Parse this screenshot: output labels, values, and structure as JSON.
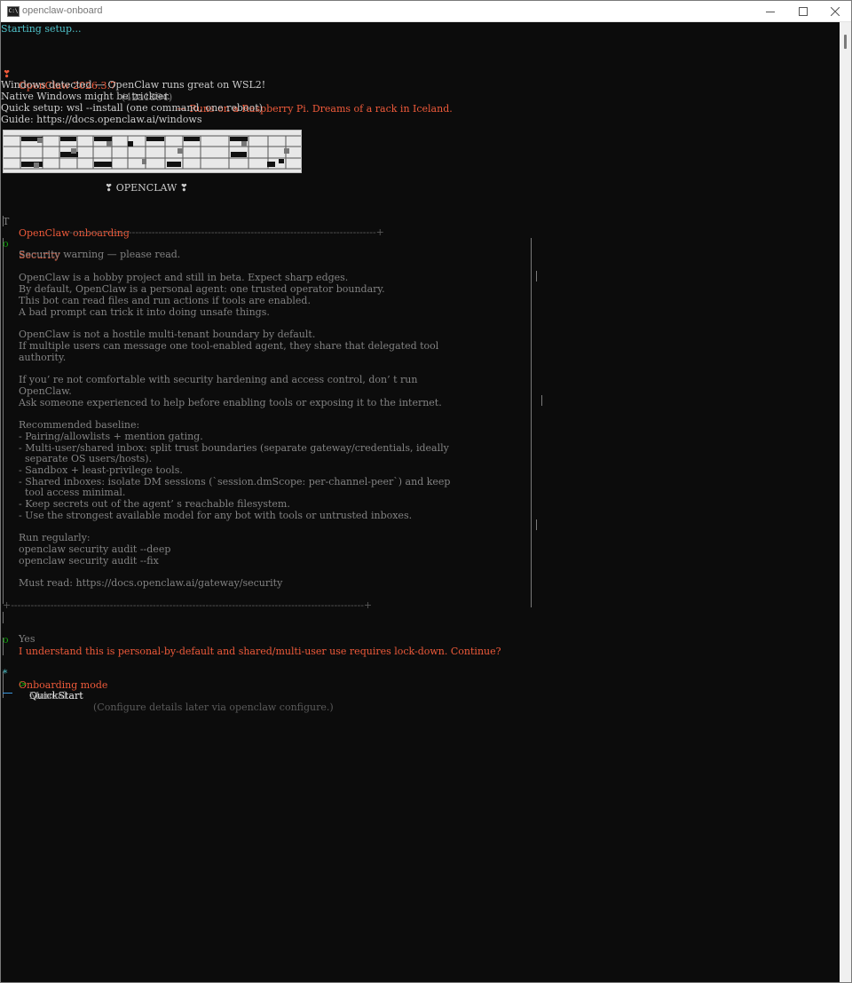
{
  "window": {
    "title": "openclaw-onboard",
    "icon": "C:\\",
    "icon_name": "terminal-icon",
    "controls": [
      "minimize-icon",
      "maximize-icon",
      "close-icon"
    ]
  },
  "colors": {
    "background": "#0c0c0c",
    "cyan": "#4fc1c9",
    "orange_red": "#ef5a3a",
    "gray": "#828282",
    "text": "#cccccc",
    "green": "#13a10e",
    "cursor": "#3a96dd"
  },
  "terminal": {
    "starting": "Starting setup...",
    "header": {
      "glyph": "❣",
      "name": "OpenClaw 2026.3.7",
      "commit": "(42a1394)",
      "tagline": "— Runs on a Raspberry Pi. Dreams of a rack in Iceland."
    },
    "windows_notice": [
      "Windows detected — OpenClaw runs great on WSL2!",
      "Native Windows might be trickier.",
      "Quick setup: wsl --install (one command, one reboot)",
      "Guide: https://docs.openclaw.ai/windows"
    ],
    "banner_subtitle": "❣ OPENCLAW ❣",
    "onboarding_marker": "T",
    "onboarding_title": "OpenClaw onboarding",
    "security": {
      "marker": "o",
      "title": "Security",
      "warning_lead": "Security warning — please read.",
      "paragraph1": [
        "OpenClaw is a hobby project and still in beta. Expect sharp edges.",
        "By default, OpenClaw is a personal agent: one trusted operator boundary.",
        "This bot can read files and run actions if tools are enabled.",
        "A bad prompt can trick it into doing unsafe things."
      ],
      "paragraph2": [
        "OpenClaw is not a hostile multi-tenant boundary by default.",
        "If multiple users can message one tool-enabled agent, they share that delegated tool",
        "authority."
      ],
      "paragraph3": [
        "If you’ re not comfortable with security hardening and access control, don’ t run",
        "OpenClaw.",
        "Ask someone experienced to help before enabling tools or exposing it to the internet."
      ],
      "baseline": [
        "Recommended baseline:",
        "- Pairing/allowlists + mention gating.",
        "- Multi-user/shared inbox: split trust boundaries (separate gateway/credentials, ideally",
        "  separate OS users/hosts).",
        "- Sandbox + least-privilege tools.",
        "- Shared inboxes: isolate DM sessions (`session.dmScope: per-channel-peer`) and keep",
        "  tool access minimal.",
        "- Keep secrets out of the agent’ s reachable filesystem.",
        "- Use the strongest available model for any bot with tools or untrusted inboxes."
      ],
      "run_regularly": [
        "Run regularly:",
        "openclaw security audit --deep",
        "openclaw security audit --fix"
      ],
      "must_read": "Must read: https://docs.openclaw.ai/gateway/security"
    },
    "confirm": {
      "marker": "o",
      "question": "I understand this is personal-by-default and shared/multi-user use requires lock-down. Continue?",
      "answer": "Yes"
    },
    "mode": {
      "marker": "*",
      "title": "Onboarding mode",
      "pointer": ">",
      "options": [
        {
          "label": "QuickStart",
          "hint": "(Configure details later via openclaw configure.)",
          "selected": true
        },
        {
          "label": "Manual",
          "hint": "",
          "selected": false
        }
      ]
    }
  }
}
